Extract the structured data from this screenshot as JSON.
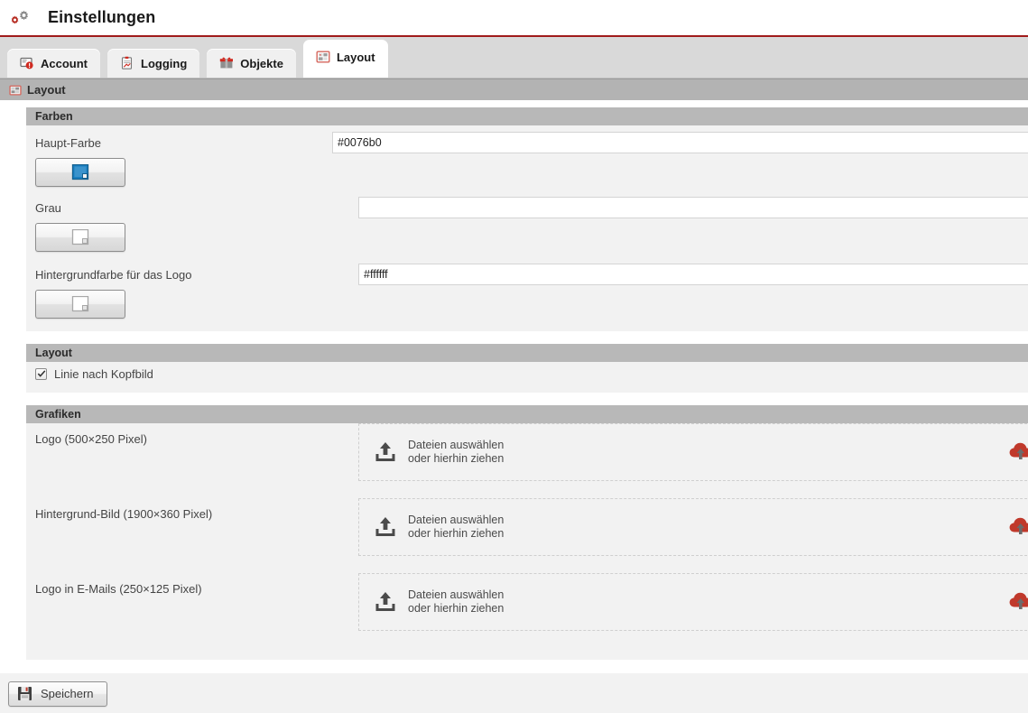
{
  "header": {
    "title": "Einstellungen",
    "icons": [
      "gear-red-icon",
      "gear-gray-icon"
    ],
    "accent_line_color": "#a01b1b"
  },
  "tabs": [
    {
      "label": "Account",
      "icon": "account-card-icon",
      "active": false
    },
    {
      "label": "Logging",
      "icon": "clipboard-log-icon",
      "active": false
    },
    {
      "label": "Objekte",
      "icon": "objects-box-icon",
      "active": false
    },
    {
      "label": "Layout",
      "icon": "layout-grid-icon",
      "active": true
    }
  ],
  "panel": {
    "title": "Layout",
    "icon": "layout-grid-icon"
  },
  "groups": {
    "colors": {
      "heading": "Farben",
      "fields": [
        {
          "label": "Haupt-Farbe",
          "value": "#0076b0",
          "placeholder": "",
          "picker_label": "",
          "swatch_color": "#1a7fc1",
          "swatch_kind": "color-swatch-blue-icon"
        },
        {
          "label": "Grau",
          "value": "",
          "placeholder": "",
          "picker_label": "",
          "swatch_color": "#ffffff",
          "swatch_kind": "color-swatch-white-icon"
        },
        {
          "label": "Hintergrundfarbe für das Logo",
          "value": "#ffffff",
          "placeholder": "",
          "picker_label": "",
          "swatch_color": "#ffffff",
          "swatch_kind": "color-swatch-white-icon"
        }
      ]
    },
    "layout": {
      "heading": "Layout",
      "checkbox": {
        "label": "Linie nach Kopfbild",
        "checked": true
      }
    },
    "graphics": {
      "heading": "Grafiken",
      "uploads": [
        {
          "label": "Logo (500×250 Pixel)",
          "line1": "Dateien auswählen",
          "line2": "oder hierhin ziehen",
          "upload_icon": "upload-tray-icon",
          "cloud_icon": "cloud-upload-icon"
        },
        {
          "label": "Hintergrund-Bild (1900×360 Pixel)",
          "line1": "Dateien auswählen",
          "line2": "oder hierhin ziehen",
          "upload_icon": "upload-tray-icon",
          "cloud_icon": "cloud-upload-icon"
        },
        {
          "label": "Logo in E-Mails (250×125 Pixel)",
          "line1": "Dateien auswählen",
          "line2": "oder hierhin ziehen",
          "upload_icon": "upload-tray-icon",
          "cloud_icon": "cloud-upload-icon"
        }
      ]
    }
  },
  "footer": {
    "save_label": "Speichern",
    "save_icon": "floppy-save-icon"
  },
  "colors": {
    "accent_red": "#c0392b",
    "tab_bar_bg": "#d9d9d9",
    "group_head_bg": "#b8b8b8",
    "panel_bg": "#f2f2f2",
    "main_color_value": "#0076b0"
  }
}
